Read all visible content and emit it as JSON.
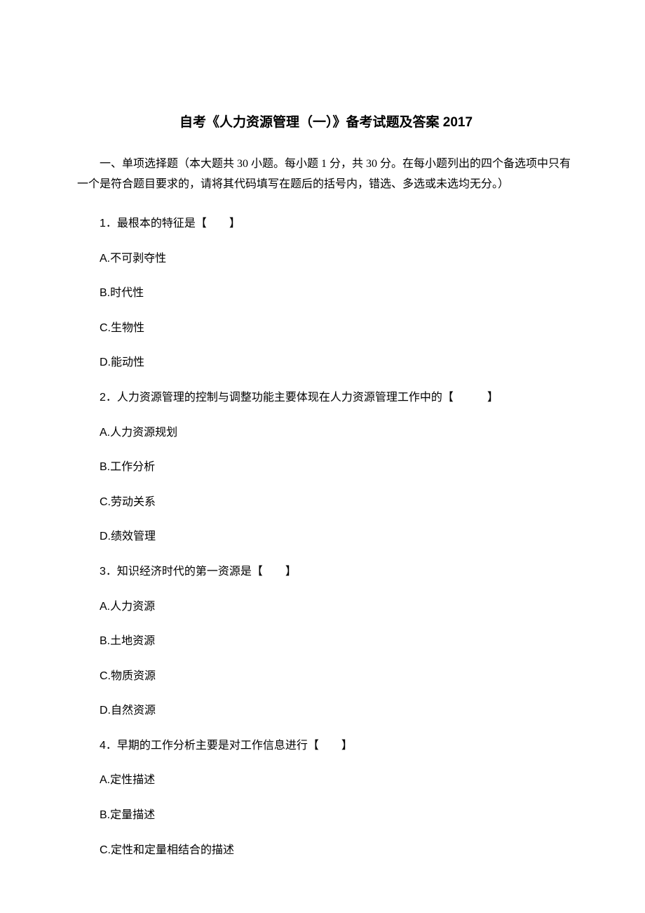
{
  "title": "自考《人力资源管理（一）》备考试题及答案 2017",
  "instructions": "一、单项选择题（本大题共 30 小题。每小题 1 分，共 30 分。在每小题列出的四个备选项中只有一个是符合题目要求的，请将其代码填写在题后的括号内，错选、多选或未选均无分。）",
  "questions": [
    {
      "number": "1",
      "text": "．最根本的特征是【　　】",
      "options": [
        {
          "label": "A.",
          "text": "不可剥夺性"
        },
        {
          "label": "B.",
          "text": "时代性"
        },
        {
          "label": "C.",
          "text": "生物性"
        },
        {
          "label": "D.",
          "text": "能动性"
        }
      ]
    },
    {
      "number": "2",
      "text": "．人力资源管理的控制与调整功能主要体现在人力资源管理工作中的【　　　】",
      "options": [
        {
          "label": "A.",
          "text": "人力资源规划"
        },
        {
          "label": "B.",
          "text": "工作分析"
        },
        {
          "label": "C.",
          "text": "劳动关系"
        },
        {
          "label": "D.",
          "text": "绩效管理"
        }
      ]
    },
    {
      "number": "3",
      "text": "．知识经济时代的第一资源是【　　】",
      "options": [
        {
          "label": "A.",
          "text": "人力资源"
        },
        {
          "label": "B.",
          "text": "土地资源"
        },
        {
          "label": "C.",
          "text": "物质资源"
        },
        {
          "label": "D.",
          "text": "自然资源"
        }
      ]
    },
    {
      "number": "4",
      "text": "．早期的工作分析主要是对工作信息进行【　　】",
      "options": [
        {
          "label": "A.",
          "text": "定性描述"
        },
        {
          "label": "B.",
          "text": "定量描述"
        },
        {
          "label": "C.",
          "text": "定性和定量相结合的描述"
        }
      ]
    }
  ]
}
